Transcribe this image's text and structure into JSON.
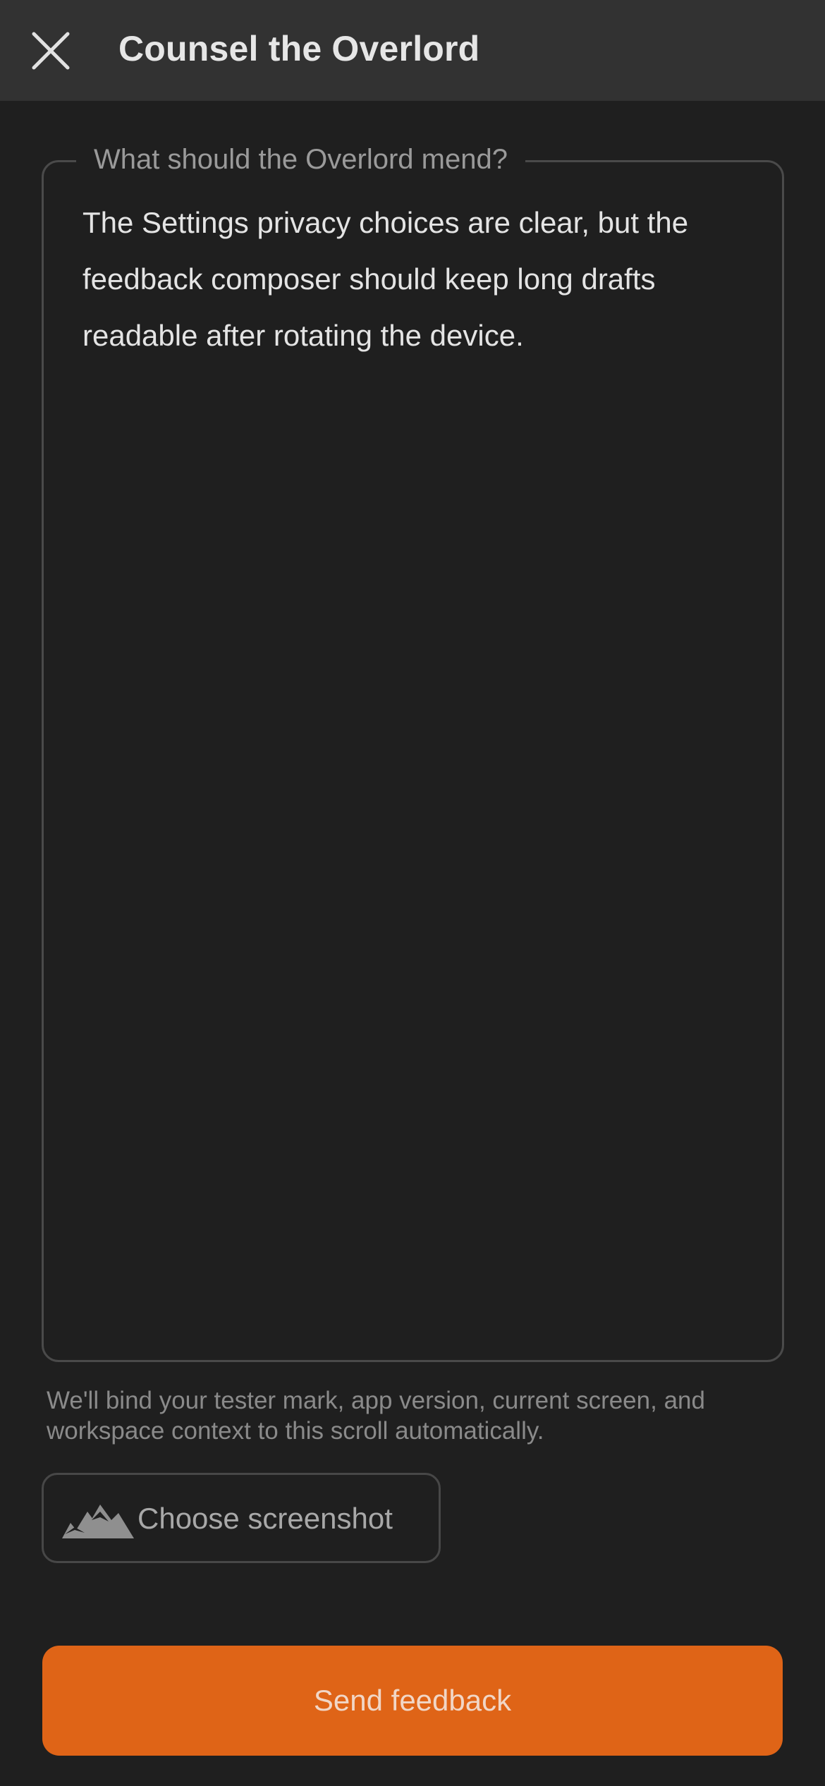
{
  "header": {
    "title": "Counsel the Overlord",
    "close_icon": "close-icon"
  },
  "feedback_field": {
    "label": "What should the Overlord mend?",
    "value": "The Settings privacy choices are clear, but the feedback composer should keep long drafts readable after rotating the device."
  },
  "helper_text": "We'll bind your tester mark, app version, current screen, and workspace context to this scroll automatically.",
  "screenshot_button": {
    "label": "Choose screenshot",
    "icon": "image-icon"
  },
  "send_button": {
    "label": "Send feedback"
  },
  "colors": {
    "background": "#1f1f1f",
    "header": "#323232",
    "accent": "#df6417"
  }
}
